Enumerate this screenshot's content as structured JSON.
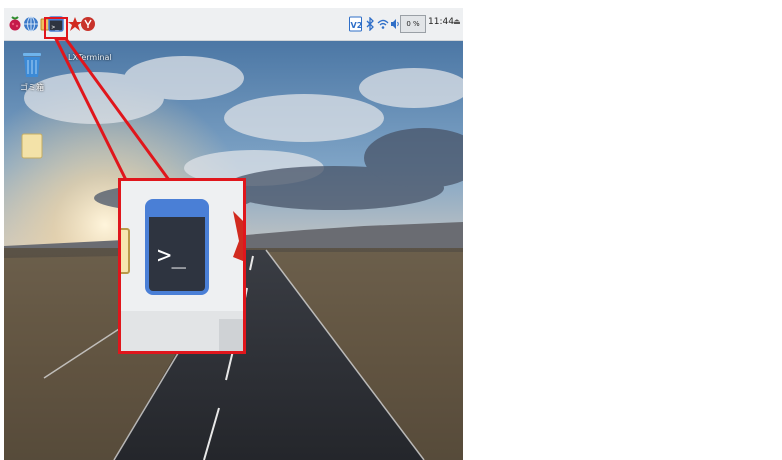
{
  "taskbar": {
    "cpu_usage": "0 %",
    "clock": "11:44",
    "left_icons": [
      "raspberry-menu-icon",
      "web-browser-icon",
      "file-manager-icon",
      "terminal-icon",
      "mathematica-icon",
      "wolfram-icon"
    ],
    "right_icons": [
      "vnc-icon",
      "bluetooth-icon",
      "wifi-icon",
      "volume-icon",
      "eject-icon"
    ]
  },
  "desktop": {
    "trash_label": "ゴミ箱",
    "folder_label": "",
    "tooltip": "LXTerminal"
  },
  "annotation": {
    "color": "#e0161c",
    "zoom_icon_glyph": ">_"
  }
}
